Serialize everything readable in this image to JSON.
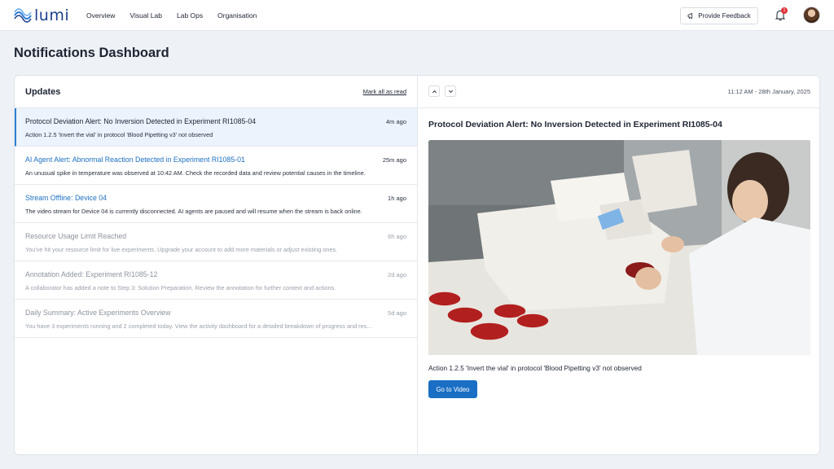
{
  "brand": {
    "name": "lumi"
  },
  "nav": {
    "links": [
      "Overview",
      "Visual Lab",
      "Lab Ops",
      "Organisation"
    ],
    "feedback_label": "Provide Feedback",
    "notification_count": "1"
  },
  "page": {
    "title": "Notifications Dashboard"
  },
  "updates": {
    "title": "Updates",
    "mark_all_label": "Mark all as read",
    "items": [
      {
        "title": "Protocol Deviation Alert: No Inversion Detected in Experiment RI1085-04",
        "time": "4m ago",
        "desc": "Action 1.2.5 'Invert the vial' in protocol 'Blood Pipetting v3' not observed"
      },
      {
        "title": "AI Agent Alert: Abnormal Reaction Detected in Experiment RI1085-01",
        "time": "25m ago",
        "desc": "An unusual spike in temperature was observed at 10:42 AM. Check the recorded data and review potential causes in the timeline."
      },
      {
        "title": "Stream Offline: Device 04",
        "time": "1h ago",
        "desc": "The video stream for Device 04 is currently disconnected. AI agents are paused and will resume when the stream is back online."
      },
      {
        "title": "Resource Usage Limit Reached",
        "time": "6h ago",
        "desc": "You've hit your resource limit for live experiments. Upgrade your account to add more materials or adjust existing ones."
      },
      {
        "title": "Annotation Added: Experiment RI1085-12",
        "time": "2d ago",
        "desc": "A collaborator has added a note to Step 3: Solution Preparation. Review the annotation for further context and actions."
      },
      {
        "title": "Daily Summary: Active Experiments Overview",
        "time": "5d ago",
        "desc": "You have 3 experiments running and 2 completed today. View the activity dashboard for a detailed breakdown of progress and res..."
      }
    ]
  },
  "detail": {
    "timestamp": "11:12 AM - 28th January, 2025",
    "title": "Protocol Deviation Alert: No Inversion Detected in Experiment RI1085-04",
    "desc": "Action 1.2.5 'Invert the vial' in protocol 'Blood Pipetting v3' not observed",
    "button_label": "Go to Video"
  }
}
